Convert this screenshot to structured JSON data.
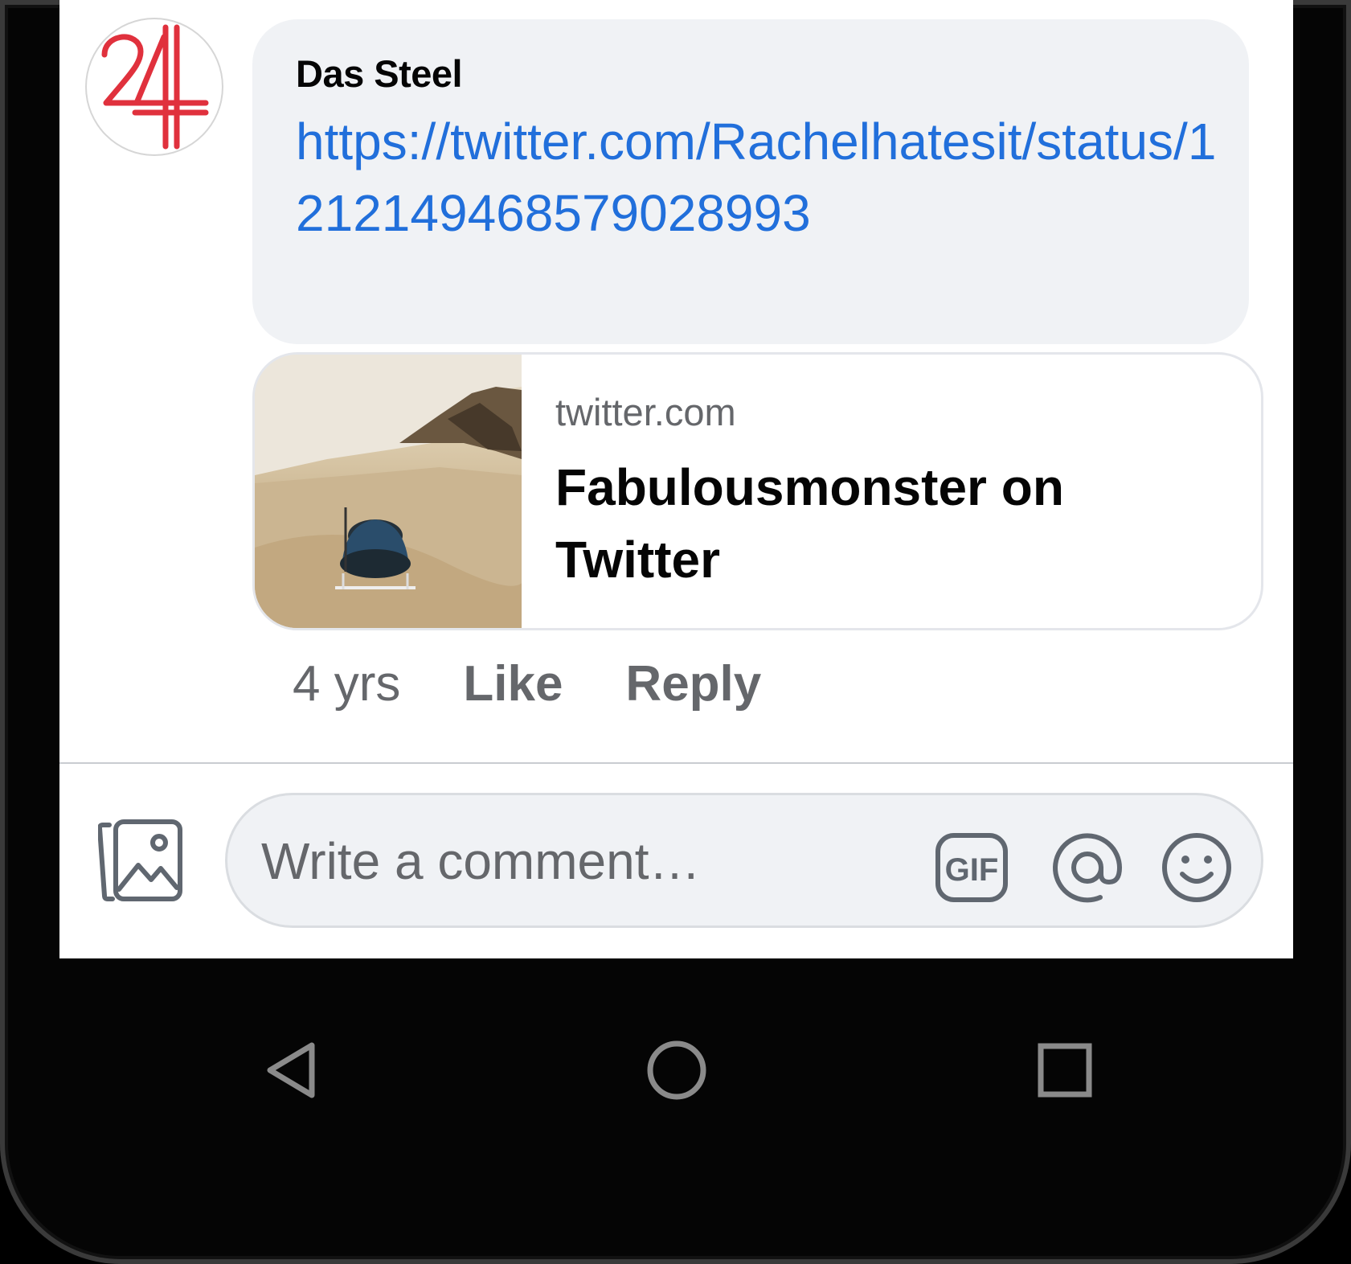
{
  "comment": {
    "author": "Das Steel",
    "link": "https://twitter.com/Rachelhatesit/status/1212149468579028993",
    "time": "4 yrs",
    "like_label": "Like",
    "reply_label": "Reply"
  },
  "link_preview": {
    "domain": "twitter.com",
    "title": "Fabulousmonster on Twitter"
  },
  "composer": {
    "placeholder": "Write a comment…",
    "gif_label": "GIF"
  },
  "icons": {
    "photo": "photo-gallery-icon",
    "gif": "gif-icon",
    "mention": "at-mention-icon",
    "emoji": "smiley-icon",
    "back": "back-triangle-icon",
    "home": "home-circle-icon",
    "recents": "recents-square-icon"
  },
  "colors": {
    "link": "#216fdb",
    "secondary_text": "#65676b",
    "bubble": "#f0f2f5",
    "avatar_logo": "#e0313d"
  }
}
